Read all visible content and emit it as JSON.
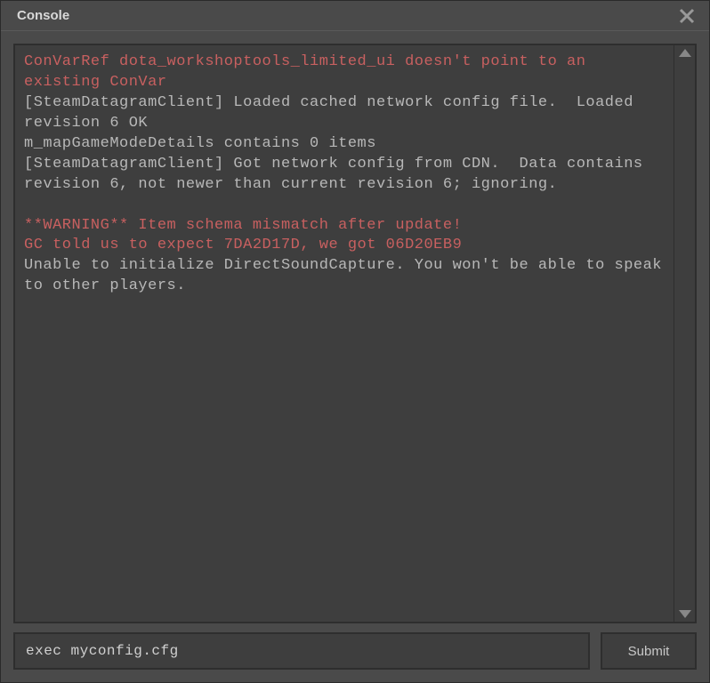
{
  "window": {
    "title": "Console"
  },
  "log": {
    "lines": [
      {
        "cls": "err",
        "text": "ConVarRef dota_workshoptools_limited_ui doesn't point to an existing ConVar"
      },
      {
        "cls": "",
        "text": "[SteamDatagramClient] Loaded cached network config file.  Loaded revision 6 OK"
      },
      {
        "cls": "",
        "text": "m_mapGameModeDetails contains 0 items"
      },
      {
        "cls": "",
        "text": "[SteamDatagramClient] Got network config from CDN.  Data contains revision 6, not newer than current revision 6; ignoring."
      },
      {
        "cls": "",
        "text": ""
      },
      {
        "cls": "warn",
        "text": "**WARNING** Item schema mismatch after update!"
      },
      {
        "cls": "warn",
        "text": "GC told us to expect 7DA2D17D, we got 06D20EB9"
      },
      {
        "cls": "",
        "text": "Unable to initialize DirectSoundCapture. You won't be able to speak to other players."
      }
    ]
  },
  "input": {
    "value": "exec myconfig.cfg",
    "placeholder": ""
  },
  "buttons": {
    "submit": "Submit"
  },
  "icons": {
    "close": "close-icon",
    "scroll_up": "scroll-up-icon",
    "scroll_down": "scroll-down-icon"
  }
}
